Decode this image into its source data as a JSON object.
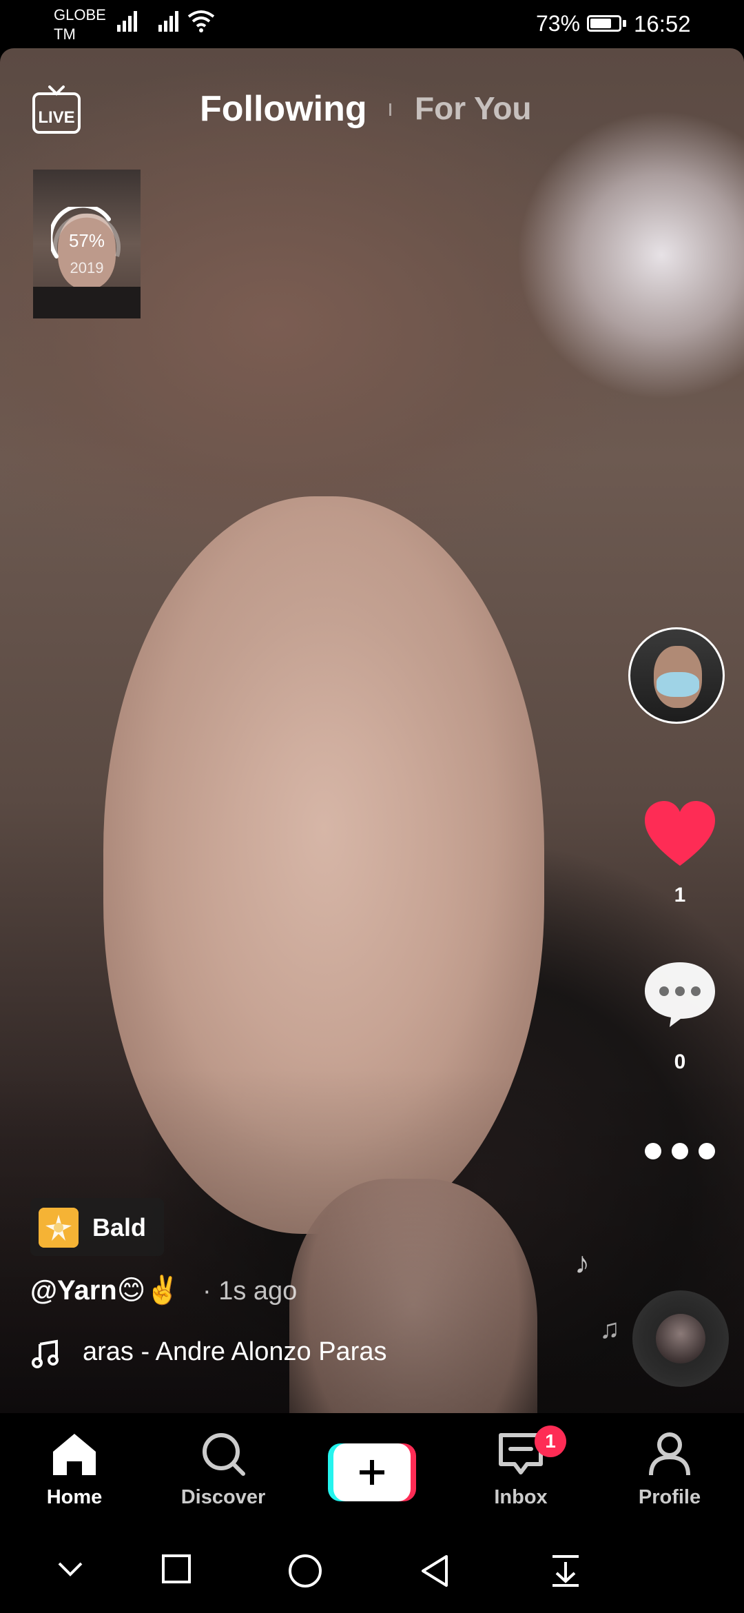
{
  "status_bar": {
    "carrier_line1": "GLOBE",
    "carrier_line2": "TM",
    "battery": "73%",
    "time": "16:52"
  },
  "top_nav": {
    "live_icon": "live-tv-icon",
    "tabs": [
      {
        "label": "Following",
        "active": true
      },
      {
        "label": "For You",
        "active": false
      }
    ]
  },
  "live_preview": {
    "progress": "57%",
    "progress_value": 0.57,
    "year": "2019"
  },
  "actions": {
    "like_count": "1",
    "comment_count": "0",
    "like_color": "#fe2c55"
  },
  "post": {
    "effect_label": "Bald",
    "username": "@Yarn😊✌️",
    "time_ago": "· 1s ago",
    "music": "aras - Andre Alonzo Paras"
  },
  "tab_bar": {
    "home": "Home",
    "discover": "Discover",
    "inbox": "Inbox",
    "inbox_badge": "1",
    "profile": "Profile"
  },
  "colors": {
    "accent_red": "#fe2c55",
    "accent_cyan": "#25f4ee"
  }
}
